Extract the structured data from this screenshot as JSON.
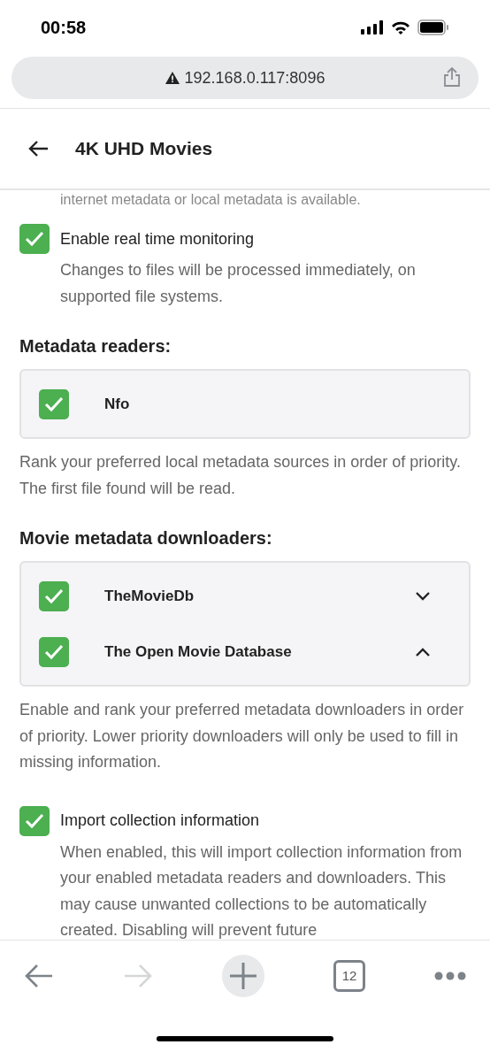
{
  "status_bar": {
    "time": "00:58"
  },
  "address_bar": {
    "url": "192.168.0.117:8096"
  },
  "header": {
    "title": "4K UHD Movies"
  },
  "content": {
    "clipped_line": "internet metadata or local metadata is available.",
    "realtime": {
      "label": "Enable real time monitoring",
      "checked": true,
      "description": "Changes to files will be processed immediately, on supported file systems."
    },
    "sections": [
      {
        "heading": "Metadata readers:",
        "items": [
          {
            "name": "Nfo",
            "checked": true
          }
        ],
        "help": "Rank your preferred local metadata sources in order of priority. The first file found will be read."
      },
      {
        "heading": "Movie metadata downloaders:",
        "items": [
          {
            "name": "TheMovieDb",
            "checked": true,
            "expanded": false
          },
          {
            "name": "The Open Movie Database",
            "checked": true,
            "expanded": true
          }
        ],
        "help": "Enable and rank your preferred metadata downloaders in order of priority. Lower priority downloaders will only be used to fill in missing information."
      }
    ],
    "collection": {
      "label": "Import collection information",
      "checked": true,
      "description": "When enabled, this will import collection information from your enabled metadata readers and downloaders. This may cause unwanted collections to be automatically created. Disabling will prevent future"
    }
  },
  "toolbar": {
    "tab_count": "12"
  }
}
